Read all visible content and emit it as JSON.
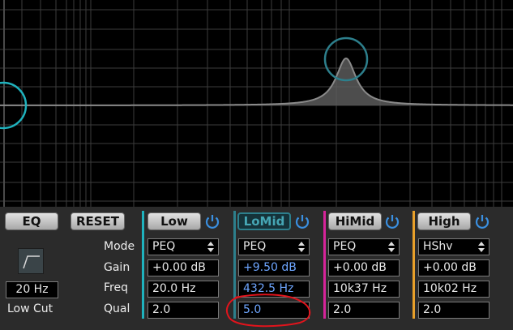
{
  "buttons": {
    "eq": "EQ",
    "reset": "RESET"
  },
  "lowcut": {
    "freq": "20 Hz",
    "label": "Low Cut"
  },
  "row_labels": [
    "Mode",
    "Gain",
    "Freq",
    "Qual"
  ],
  "colors": {
    "low": "#1fb2bd",
    "lomid": "#2d7f8c",
    "himid": "#d6249a",
    "high": "#e8a02a",
    "annotation": "#e0141c",
    "curve": "#8a8a8a"
  },
  "bands": [
    {
      "name": "Low",
      "mode": "PEQ",
      "gain": "+0.00 dB",
      "freq": "20.0 Hz",
      "qual": "2.0",
      "active": false
    },
    {
      "name": "LoMid",
      "mode": "PEQ",
      "gain": "+9.50 dB",
      "freq": "432.5 Hz",
      "qual": "5.0",
      "active": true
    },
    {
      "name": "HiMid",
      "mode": "PEQ",
      "gain": "+0.00 dB",
      "freq": "10k37 Hz",
      "qual": "2.0",
      "active": false
    },
    {
      "name": "High",
      "mode": "HShv",
      "gain": "+0.00 dB",
      "freq": "10k02 Hz",
      "qual": "2.0",
      "active": false
    }
  ]
}
